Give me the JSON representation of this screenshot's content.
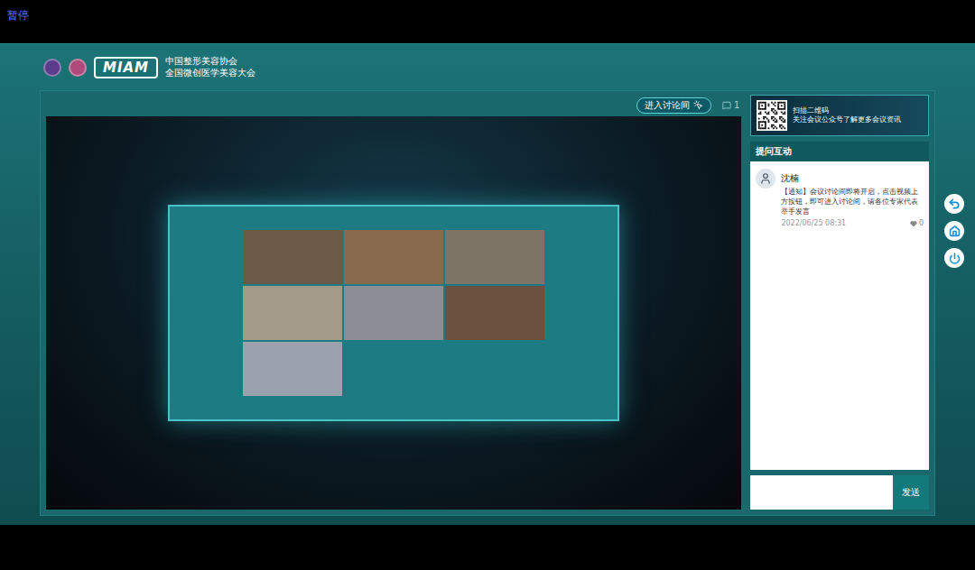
{
  "top_bar": {
    "pause_label": "暂停"
  },
  "header": {
    "logo_text": "MIAM",
    "org_line1": "中国整形美容协会",
    "org_line2": "全国微创医学美容大会"
  },
  "video": {
    "enter_button": "进入讨论间",
    "comment_count": "1"
  },
  "qr_banner": {
    "title": "扫描二维码",
    "subtitle": "关注会议公众号了解更多会议资讯"
  },
  "chat": {
    "title": "提问互动",
    "messages": [
      {
        "author": "沈楠",
        "text": "【通知】会议讨论间即将开启，点击视频上方按钮，即可进入讨论间，请各位专家代表举手发言",
        "time": "2022/06/25 08:31",
        "likes": "0"
      }
    ],
    "send_button": "发送"
  }
}
